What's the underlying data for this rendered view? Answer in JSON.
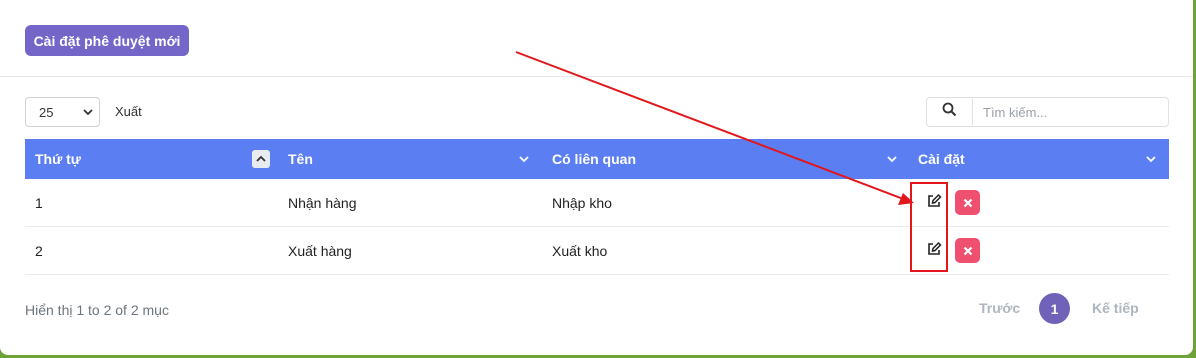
{
  "toolbar": {
    "new_approval_label": "Cài đặt phê duyệt mới"
  },
  "controls": {
    "page_size": "25",
    "export_label": "Xuất",
    "search_placeholder": "Tìm kiếm..."
  },
  "table": {
    "headers": [
      "Thứ tự",
      "Tên",
      "Có liên quan",
      "Cài đặt"
    ],
    "rows": [
      {
        "order": "1",
        "name": "Nhận hàng",
        "related": "Nhập kho"
      },
      {
        "order": "2",
        "name": "Xuất hàng",
        "related": "Xuất kho"
      }
    ]
  },
  "footer": {
    "info": "Hiển thị 1 to 2 of 2 mục",
    "prev": "Trước",
    "page": "1",
    "next": "Kế tiếp"
  },
  "colors": {
    "primary_button": "#7466c9",
    "table_header": "#5b7ff3",
    "delete": "#f05070",
    "annotation": "#e3161b",
    "background": "#6fa23a"
  }
}
